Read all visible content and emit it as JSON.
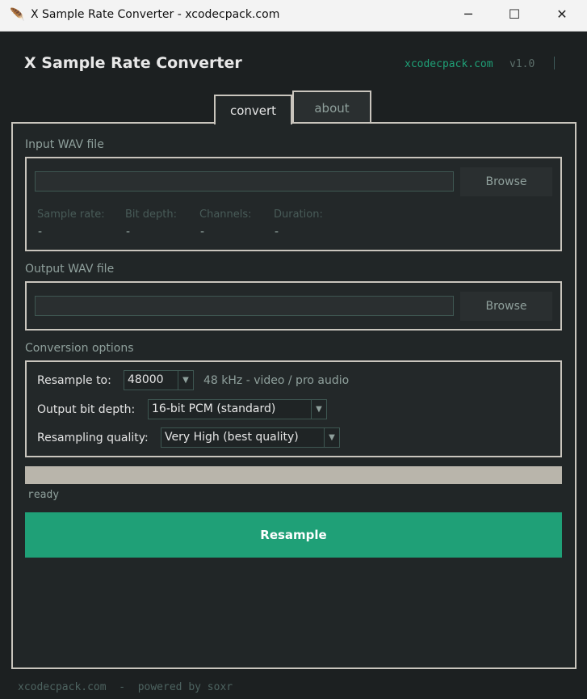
{
  "window": {
    "title": "X Sample Rate Converter - xcodecpack.com",
    "icon": "feather-icon",
    "controls": {
      "minimize": "─",
      "maximize": "☐",
      "close": "✕"
    }
  },
  "header": {
    "title": "X Sample Rate Converter",
    "site": "xcodecpack.com",
    "version": "v1.0",
    "separator": "|"
  },
  "tabs": [
    {
      "label": "convert",
      "active": true
    },
    {
      "label": "about",
      "active": false
    }
  ],
  "input": {
    "section_label": "Input WAV file",
    "path": "",
    "browse": "Browse",
    "info": [
      {
        "label": "Sample rate:",
        "value": "-"
      },
      {
        "label": "Bit depth:",
        "value": "-"
      },
      {
        "label": "Channels:",
        "value": "-"
      },
      {
        "label": "Duration:",
        "value": "-"
      }
    ]
  },
  "output": {
    "section_label": "Output WAV file",
    "path": "",
    "browse": "Browse"
  },
  "options": {
    "section_label": "Conversion options",
    "resample_label": "Resample to:",
    "resample_value": "48000",
    "resample_hint": "48 kHz - video / pro audio",
    "bitdepth_label": "Output bit depth:",
    "bitdepth_value": "16-bit PCM (standard)",
    "quality_label": "Resampling quality:",
    "quality_value": "Very High (best quality)"
  },
  "progress": {
    "percent": 0
  },
  "status": "ready",
  "resample_button": "Resample",
  "footer": "xcodecpack.com  -  powered by soxr",
  "colors": {
    "accent": "#1fa077",
    "background": "#1c2021",
    "border": "#c9c5bd"
  }
}
